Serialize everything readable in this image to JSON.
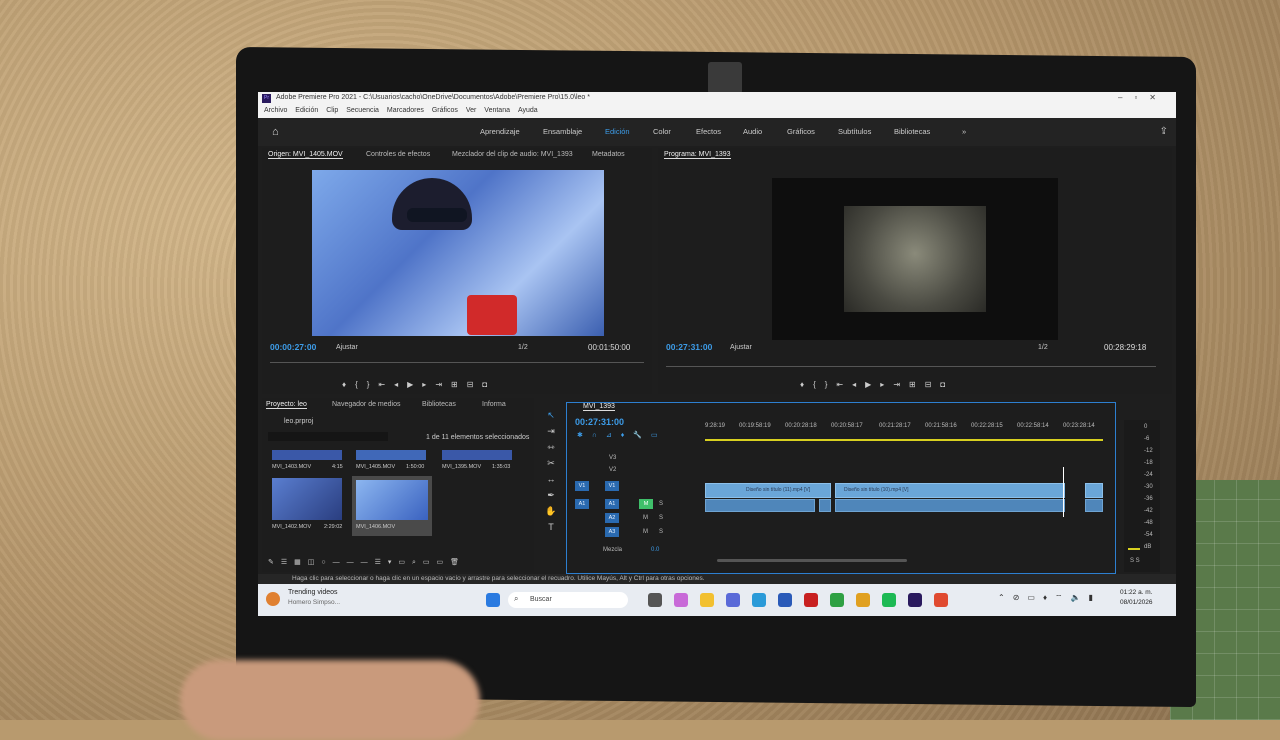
{
  "window": {
    "title": "Adobe Premiere Pro 2021 - C:\\Usuarios\\cacho\\OneDrive\\Documentos\\Adobe\\Premiere Pro\\15.0\\leo *",
    "logo": "Pr"
  },
  "menu": [
    "Archivo",
    "Edición",
    "Clip",
    "Secuencia",
    "Marcadores",
    "Gráficos",
    "Ver",
    "Ventana",
    "Ayuda"
  ],
  "workspaces": {
    "items": [
      "Aprendizaje",
      "Ensamblaje",
      "Edición",
      "Color",
      "Efectos",
      "Audio",
      "Gráficos",
      "Subtítulos",
      "Bibliotecas"
    ],
    "active": "Edición",
    "more": "»"
  },
  "source": {
    "tabs": [
      "Origen: MVI_1405.MOV",
      "Controles de efectos",
      "Mezclador del clip de audio: MVI_1393",
      "Metadatos"
    ],
    "timecode": "00:00:27:00",
    "fit": "Ajustar",
    "resolution": "1/2",
    "duration": "00:01:50:00"
  },
  "program": {
    "tab": "Programa: MVI_1393",
    "timecode": "00:27:31:00",
    "fit": "Ajustar",
    "resolution": "1/2",
    "duration": "00:28:29:18"
  },
  "project": {
    "tabs": [
      "Proyecto: leo",
      "Navegador de medios",
      "Bibliotecas",
      "Informa"
    ],
    "file": "leo.prproj",
    "selection": "1 de 11 elementos seleccionados",
    "row1": [
      {
        "name": "MVI_1403.MOV",
        "dur": "4:15"
      },
      {
        "name": "MVI_1405.MOV",
        "dur": "1:50:00"
      },
      {
        "name": "MVI_1395.MOV",
        "dur": "1:35:03"
      }
    ],
    "row2": [
      {
        "name": "MVI_1402.MOV",
        "dur": "2:29:02"
      },
      {
        "name": "MVI_1406.MOV",
        "dur": ""
      }
    ]
  },
  "timeline": {
    "tab": "MVI_1393",
    "timecode": "00:27:31:00",
    "ruler": [
      "9:28:19",
      "00:19:58:19",
      "00:20:28:18",
      "00:20:58:17",
      "00:21:28:17",
      "00:21:58:16",
      "00:22:28:15",
      "00:22:58:14",
      "00:23:28:14"
    ],
    "video_tracks": [
      "V3",
      "V2",
      "V1"
    ],
    "audio_tracks": [
      "A1",
      "A2",
      "A3"
    ],
    "mix_label": "Mezcla",
    "mix_value": "0.0",
    "clip1": "Diseño sin título (11).mp4 [V]",
    "clip2": "Diseño sin título (10).mp4 [V]",
    "m": "M",
    "s": "S"
  },
  "meter": {
    "scale": [
      "0",
      "-6",
      "-12",
      "-18",
      "-24",
      "-30",
      "-36",
      "-42",
      "-48",
      "-54",
      "dB"
    ],
    "footer": "S S"
  },
  "status_text": "Haga clic para seleccionar o haga clic en un espacio vacío y arrastre para seleccionar el recuadro. Utilice Mayús, Alt y Ctrl para otras opciones.",
  "taskbar": {
    "news_title": "Trending videos",
    "news_sub": "Homero Simpso...",
    "search": "Buscar",
    "time": "01:22 a. m.",
    "date": "08/01/2026"
  }
}
